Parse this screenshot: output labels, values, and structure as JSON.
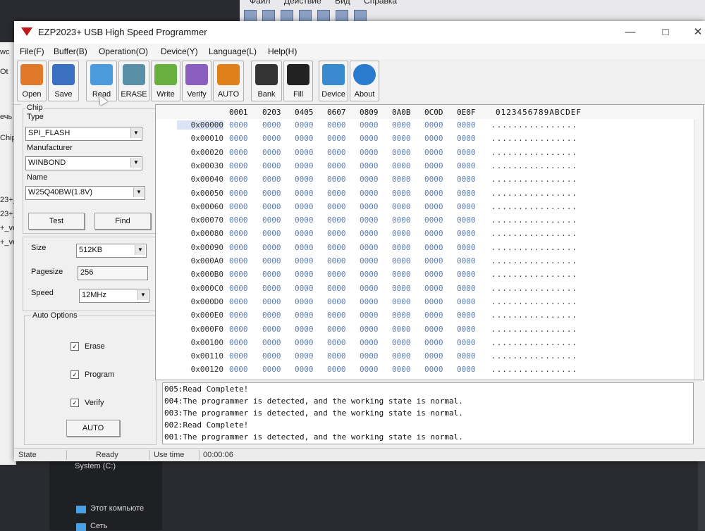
{
  "window": {
    "title": "EZP2023+ USB High Speed Programmer"
  },
  "menu": [
    "File(F)",
    "Buffer(B)",
    "Operation(O)",
    "Device(Y)",
    "Language(L)",
    "Help(H)"
  ],
  "toolbar": [
    {
      "label": "Open",
      "icon": "folder-open-icon",
      "color": "#e07a2a"
    },
    {
      "label": "Save",
      "icon": "floppy-disk-icon",
      "color": "#3b6fc0"
    },
    {
      "label": "Read",
      "icon": "read-chip-icon",
      "color": "#4a9adc"
    },
    {
      "label": "ERASE",
      "icon": "erase-bin-icon",
      "color": "#5a8fa8"
    },
    {
      "label": "Write",
      "icon": "write-arrow-icon",
      "color": "#6ab040"
    },
    {
      "label": "Verify",
      "icon": "verify-icon",
      "color": "#8a5fc0"
    },
    {
      "label": "AUTO",
      "icon": "auto-runner-icon",
      "color": "#e0801a"
    },
    {
      "label": "Bank",
      "icon": "bank-chip-icon",
      "color": "#333333"
    },
    {
      "label": "Fill",
      "icon": "fill-bin-icon",
      "color": "#222222"
    },
    {
      "label": "Device",
      "icon": "device-gear-icon",
      "color": "#3a8ad0"
    },
    {
      "label": "About",
      "icon": "about-question-icon",
      "color": "#2a7ad0"
    }
  ],
  "chip": {
    "group_label": "Chip",
    "type_label": "Type",
    "type_value": "SPI_FLASH",
    "manufacturer_label": "Manufacturer",
    "manufacturer_value": "WINBOND",
    "name_label": "Name",
    "name_value": "W25Q40BW(1.8V)",
    "test_button": "Test",
    "find_button": "Find"
  },
  "params": {
    "size_label": "Size",
    "size_value": "512KB",
    "pagesize_label": "Pagesize",
    "pagesize_value": "256",
    "speed_label": "Speed",
    "speed_value": "12MHz"
  },
  "auto_options": {
    "group_label": "Auto Options",
    "erase": "Erase",
    "program": "Program",
    "verify": "Verify",
    "erase_checked": true,
    "program_checked": true,
    "verify_checked": true,
    "auto_button": "AUTO"
  },
  "hex": {
    "header_cols": [
      "0001",
      "0203",
      "0405",
      "0607",
      "0809",
      "0A0B",
      "0C0D",
      "0E0F"
    ],
    "ascii_header": "0123456789ABCDEF",
    "cell": "0000",
    "ascii_row": "................",
    "rows": [
      "0x00000",
      "0x00010",
      "0x00020",
      "0x00030",
      "0x00040",
      "0x00050",
      "0x00060",
      "0x00070",
      "0x00080",
      "0x00090",
      "0x000A0",
      "0x000B0",
      "0x000C0",
      "0x000D0",
      "0x000E0",
      "0x000F0",
      "0x00100",
      "0x00110",
      "0x00120"
    ]
  },
  "log": [
    "005:Read Complete!",
    "004:The programmer is detected, and the working state is normal.",
    "003:The programmer is detected, and the working state is normal.",
    "002:Read Complete!",
    "001:The programmer is detected, and the working state is normal."
  ],
  "status": {
    "state_label": "State",
    "state_value": "Ready",
    "time_label": "Use time",
    "time_value": "00:00:06"
  },
  "background": {
    "top_menu": [
      "Файл",
      "Действие",
      "Вид",
      "Справка"
    ],
    "left_fragments": [
      "wc",
      "Ot",
      "ечь",
      "Chip",
      "23+_",
      "23+_",
      "+_ve",
      "+_ve"
    ],
    "explorer_items": [
      "System (C:)",
      "Этот компьюте",
      "Сеть"
    ]
  }
}
